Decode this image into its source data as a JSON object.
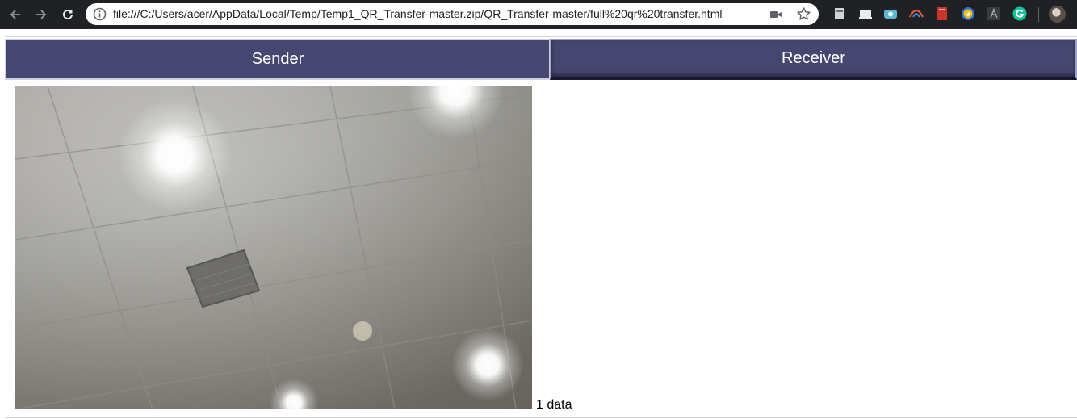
{
  "browser": {
    "url": "file:///C:/Users/acer/AppData/Local/Temp/Temp1_QR_Transfer-master.zip/QR_Transfer-master/full%20qr%20transfer.html",
    "icons": [
      "back-icon",
      "forward-icon",
      "reload-icon",
      "info-icon",
      "camera-icon",
      "star-icon"
    ],
    "extensions": [
      "extension-1-icon",
      "extension-2-icon",
      "extension-3-icon",
      "extension-4-icon",
      "extension-5-icon",
      "extension-6-icon",
      "extension-7-icon",
      "grammarly-icon"
    ]
  },
  "tabs": [
    {
      "label": "Sender"
    },
    {
      "label": "Receiver"
    }
  ],
  "colors": {
    "tab_bg": "#464770",
    "chrome_bg": "#202124"
  },
  "status": {
    "count_text": "1 data"
  }
}
